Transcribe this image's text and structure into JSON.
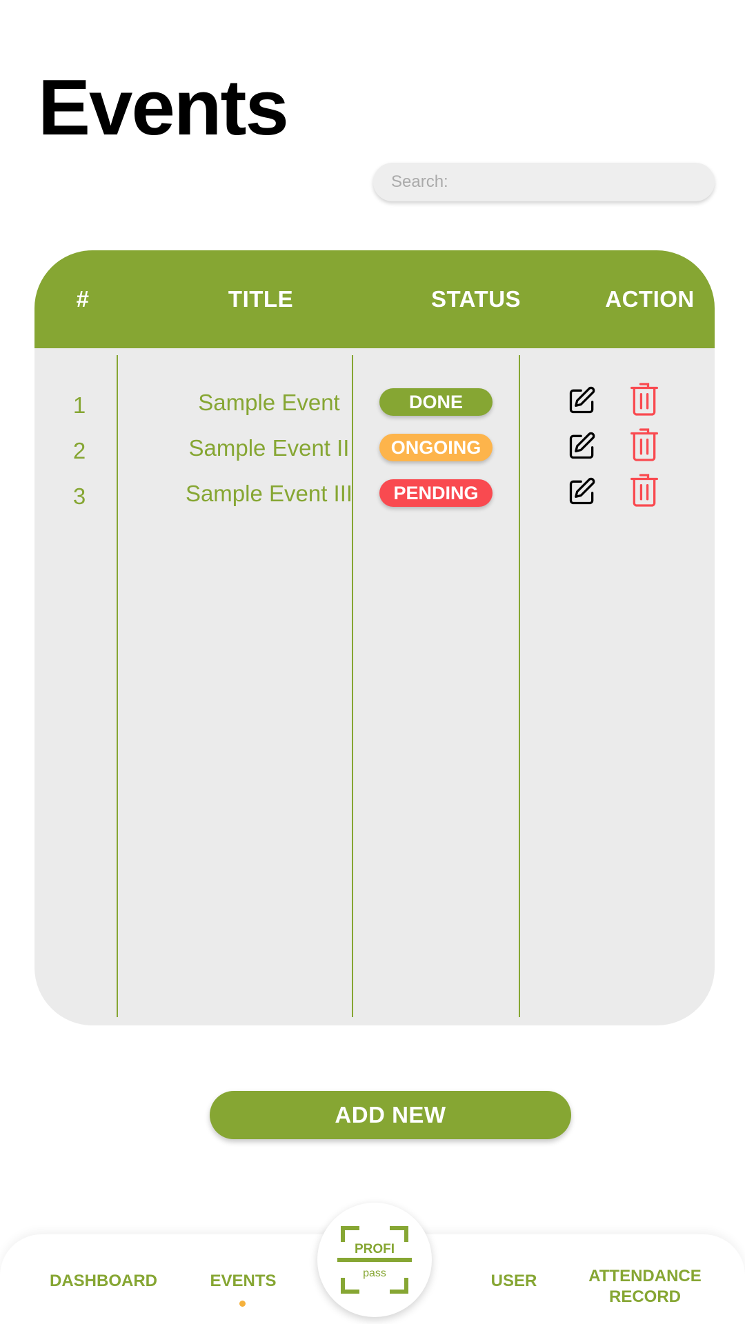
{
  "header": {
    "title": "Events"
  },
  "search": {
    "placeholder": "Search:"
  },
  "table": {
    "columns": [
      "#",
      "TITLE",
      "STATUS",
      "ACTION"
    ],
    "rows": [
      {
        "num": "1",
        "title": "Sample Event",
        "status": "DONE",
        "status_color": "#86a633"
      },
      {
        "num": "2",
        "title": "Sample Event II",
        "status": "ONGOING",
        "status_color": "#fdb44b"
      },
      {
        "num": "3",
        "title": "Sample Event III",
        "status": "PENDING",
        "status_color": "#f94a50"
      }
    ],
    "row_icons": [
      "edit-icon",
      "trash-icon"
    ]
  },
  "add_button": {
    "label": "ADD NEW"
  },
  "nav": {
    "items": [
      {
        "label": "DASHBOARD"
      },
      {
        "label": "EVENTS"
      },
      {
        "label": "USER"
      },
      {
        "label_line1": "ATTENDANCE",
        "label_line2": "RECORD"
      }
    ],
    "active": "EVENTS",
    "logo": {
      "word1": "PROFI",
      "word2": "pass"
    }
  },
  "colors": {
    "accent": "#86a633",
    "ongoing": "#fdb44b",
    "pending": "#f94a50",
    "dot": "#f5b13d"
  }
}
